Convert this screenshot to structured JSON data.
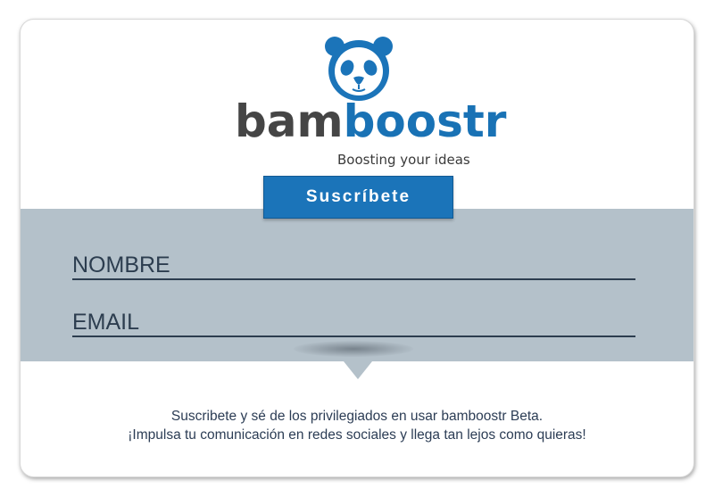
{
  "brand": {
    "name_part1": "bam",
    "name_part2": "boostr",
    "tagline": "Boosting your ideas",
    "logo_icon": "panda-face-icon",
    "colors": {
      "primary_blue": "#1b74b9",
      "dark_gray": "#454545",
      "band_gray": "#b4c1ca",
      "text_navy": "#2c3d55"
    }
  },
  "form": {
    "subscribe_label": "Suscríbete",
    "name_placeholder": "NOMBRE",
    "email_placeholder": "EMAIL"
  },
  "footer": {
    "line1": "Suscribete y sé de los privilegiados en usar bamboostr Beta.",
    "line2": "¡Impulsa tu comunicación en redes sociales y llega tan lejos como quieras!"
  }
}
